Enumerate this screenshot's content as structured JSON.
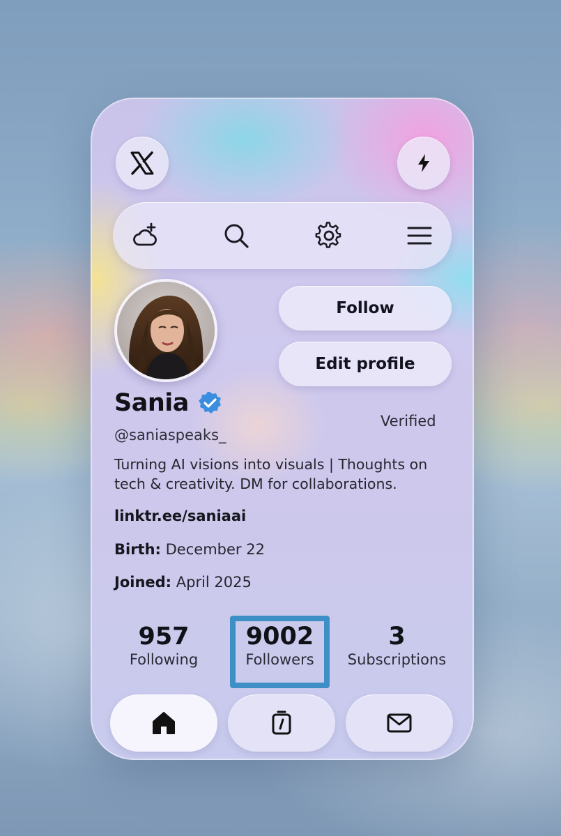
{
  "header": {
    "logo_icon": "x-logo-icon",
    "action_icon": "lightning-icon"
  },
  "toolbar": {
    "icons": [
      "cloud-add-icon",
      "search-icon",
      "gear-icon",
      "menu-icon"
    ]
  },
  "profile": {
    "name": "Sania",
    "handle": "@saniaspeaks_",
    "verified_label": "Verified",
    "bio": "Turning AI visions into visuals | Thoughts on tech & creativity. DM for collaborations.",
    "link": "linktr.ee/saniaai",
    "birth_label": "Birth:",
    "birth_value": "December 22",
    "joined_label": "Joined:",
    "joined_value": "April 2025"
  },
  "buttons": {
    "follow": "Follow",
    "edit_profile": "Edit profile"
  },
  "stats": [
    {
      "value": "957",
      "label": "Following"
    },
    {
      "value": "9002",
      "label": "Followers"
    },
    {
      "value": "3",
      "label": "Subscriptions"
    }
  ],
  "bottom_nav": {
    "items": [
      "home-icon",
      "clock-icon",
      "mail-icon"
    ],
    "active": "home-icon"
  },
  "colors": {
    "verified_badge": "#3b8de0",
    "highlight_border": "#3d8fc5",
    "text_primary": "#111118"
  }
}
